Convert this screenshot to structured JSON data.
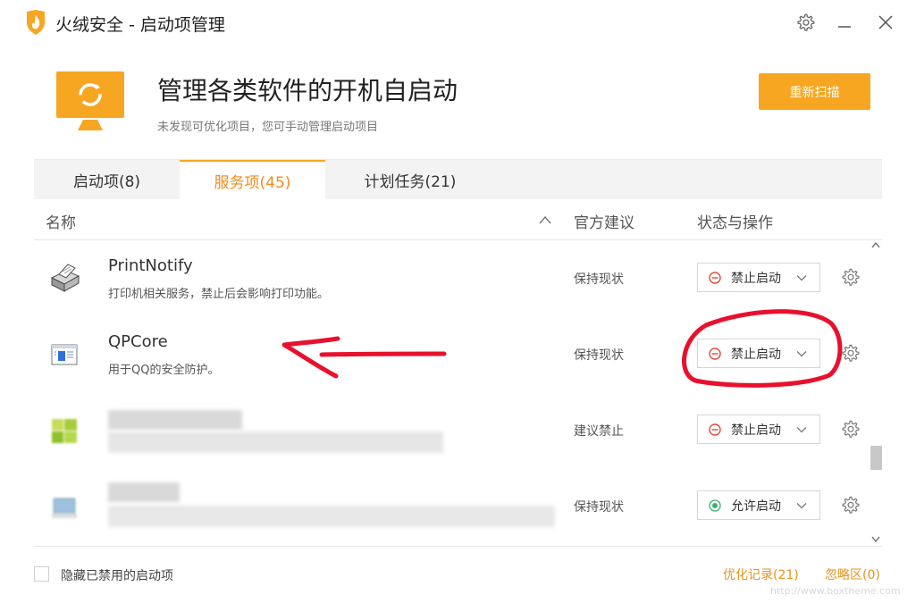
{
  "window": {
    "title": "火绒安全 - 启动项管理"
  },
  "hero": {
    "title": "管理各类软件的开机自启动",
    "subtitle": "未发现可优化项目，您可手动管理启动项目",
    "rescan_label": "重新扫描"
  },
  "tabs": [
    {
      "label": "启动项(8)"
    },
    {
      "label": "服务项(45)",
      "active": true
    },
    {
      "label": "计划任务(21)"
    }
  ],
  "table": {
    "col_name": "名称",
    "col_advice": "官方建议",
    "col_status": "状态与操作"
  },
  "rows": [
    {
      "name": "PrintNotify",
      "desc": "打印机相关服务，禁止后会影响打印功能。",
      "advice": "保持现状",
      "status": "禁止启动",
      "status_type": "disabled",
      "icon": "printer-icon"
    },
    {
      "name": "QPCore",
      "desc": "用于QQ的安全防护。",
      "advice": "保持现状",
      "status": "禁止启动",
      "status_type": "disabled",
      "icon": "window-app-icon"
    },
    {
      "name": "",
      "desc": "",
      "advice": "建议禁止",
      "status": "禁止启动",
      "status_type": "disabled",
      "icon": "blurred-app-icon"
    },
    {
      "name": "",
      "desc": "",
      "advice": "保持现状",
      "status": "允许启动",
      "status_type": "enabled",
      "icon": "blurred-app-icon"
    }
  ],
  "footer": {
    "hide_disabled_label": "隐藏已禁用的启动项",
    "optimize_record": "优化记录(21)",
    "ignore_zone": "忽略区(0)",
    "watermark": "http://www.boxtheme.com"
  },
  "colors": {
    "accent": "#f7a622",
    "tab_active_text": "#f28c1e",
    "link": "#e6941f",
    "disabled_icon": "#e14b3b",
    "enabled_icon": "#3cb371",
    "annotation_red": "#e8112d"
  }
}
